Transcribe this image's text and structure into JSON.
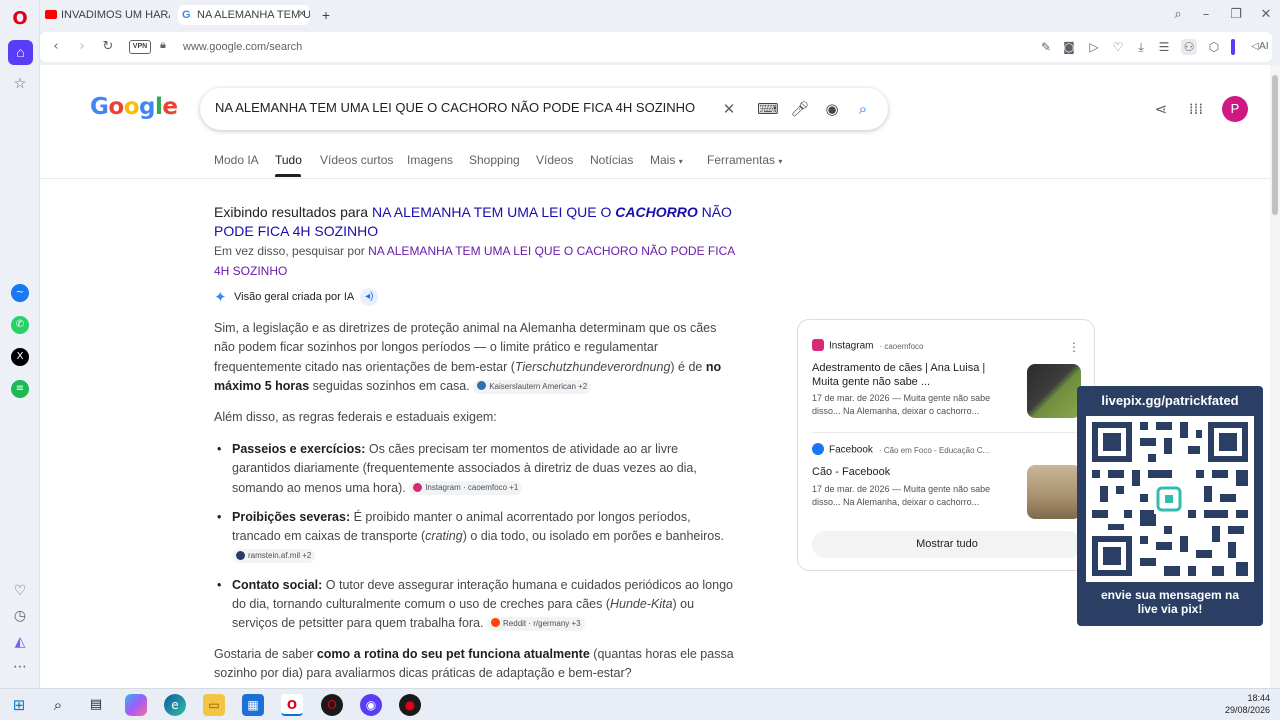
{
  "browser": {
    "tabs": [
      {
        "label": "INVADIMOS UM HARAS N"
      },
      {
        "label": "NA ALEMANHA TEM UMA"
      }
    ],
    "vpn_label": "VPN",
    "url": "www.google.com/search",
    "ai_label": "AI"
  },
  "search": {
    "query": "NA ALEMANHA TEM UMA LEI QUE O CACHORO NÃO PODE FICA 4H SOZINHO",
    "avatar_letter": "P",
    "tabs": [
      "Modo IA",
      "Tudo",
      "Vídeos curtos",
      "Imagens",
      "Shopping",
      "Vídeos",
      "Notícias",
      "Mais",
      "Ferramentas"
    ]
  },
  "correction": {
    "showing_prefix": "Exibindo resultados para",
    "showing_part1": "NA ALEMANHA TEM UMA LEI QUE O",
    "showing_emph": "CACHORRO",
    "showing_part2": "NÃO PODE FICA 4H SOZINHO",
    "instead_prefix": "Em vez disso, pesquisar por",
    "instead_link": "NA ALEMANHA TEM UMA LEI QUE O CACHORO NÃO PODE FICA 4H SOZINHO"
  },
  "ai_overview": {
    "label": "Visão geral criada por IA",
    "p1_a": "Sim, a legislação e as diretrizes de proteção animal na Alemanha determinam que os cães não podem ficar sozinhos por longos períodos — o limite prático e regulamentar frequentemente citado nas orientações de bem-estar (",
    "p1_i": "Tierschutzhundeverordnung",
    "p1_b": ") é de ",
    "p1_bold": "no máximo 5 horas",
    "p1_c": " seguidas sozinhos em casa.",
    "p1_chip": "Kaiserslautern American +2",
    "p2": "Além disso, as regras federais e estaduais exigem:",
    "b1_title": "Passeios e exercícios:",
    "b1_text": " Os cães precisam ter momentos de atividade ao ar livre garantidos diariamente (frequentemente associados à diretriz de duas vezes ao dia, somando ao menos uma hora).",
    "b1_chip": "Instagram · caoemfoco +1",
    "b2_title": "Proibições severas:",
    "b2_text_a": " É proibido manter o animal acorrentado por longos períodos, trancado em caixas de transporte (",
    "b2_i": "crating",
    "b2_text_b": ") o dia todo, ou isolado em porões e banheiros.",
    "b2_chip": "ramstein.af.mil +2",
    "b3_title": "Contato social:",
    "b3_text_a": " O tutor deve assegurar interação humana e cuidados periódicos ao longo do dia, tornando culturalmente comum o uso de creches para cães (",
    "b3_i": "Hunde-Kita",
    "b3_text_b": ") ou serviços de petsitter para quem trabalha fora.",
    "b3_chip": "Reddit · r/germany +3",
    "p3_a": "Gostaria de saber ",
    "p3_bold": "como a rotina do seu pet funciona atualmente",
    "p3_b": " (quantas horas ele passa sozinho por dia) para avaliarmos dicas práticas de adaptação e bem-estar?"
  },
  "sources_card": {
    "items": [
      {
        "source": "Instagram",
        "sub": "caoemfoco",
        "title": "Adestramento de cães | Ana Luisa | Muita gente não sabe ...",
        "snippet": "17 de mar. de 2026 — Muita gente não sabe disso... Na Alemanha, deixar o cachorro..."
      },
      {
        "source": "Facebook",
        "sub": "Cão em Foco - Educação C...",
        "title": "Cão - Facebook",
        "snippet": "17 de mar. de 2026 — Muita gente não sabe disso... Na Alemanha, deixar o cachorro..."
      }
    ],
    "show_all": "Mostrar tudo"
  },
  "overlay": {
    "top": "livepix.gg/patrickfated",
    "bottom_1": "envie sua mensagem na",
    "bottom_2": "live via pix!"
  },
  "taskbar": {
    "time": "18:44",
    "date": "29/08/2026"
  },
  "colors": {
    "opera_accent": "#5b3cf6",
    "link": "#1a0dab",
    "visited_link": "#681da8",
    "avatar": "#d01884",
    "overlay_bg": "#2a3f63"
  }
}
